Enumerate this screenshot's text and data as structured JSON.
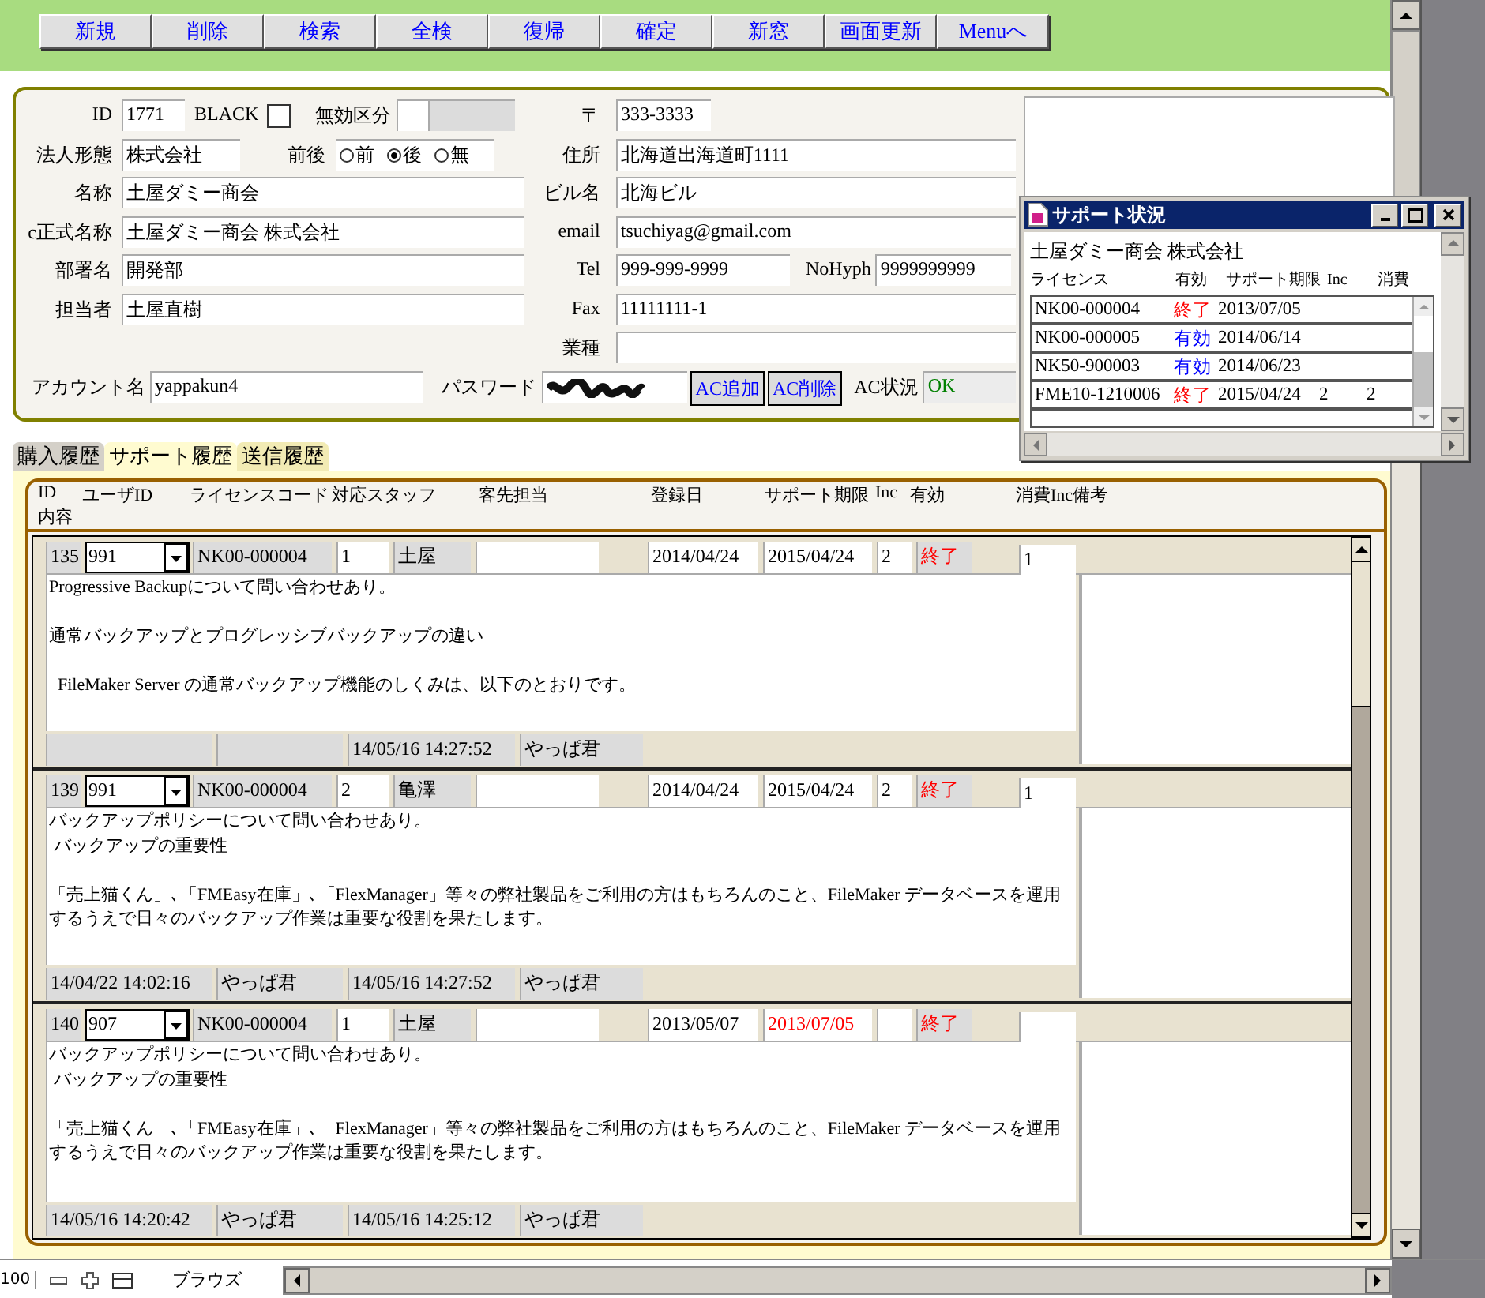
{
  "toolbar": {
    "buttons": [
      "新規",
      "削除",
      "検索",
      "全検",
      "復帰",
      "確定",
      "新窓",
      "画面更新",
      "Menuへ"
    ]
  },
  "form": {
    "id": {
      "label": "ID",
      "value": "1771"
    },
    "black": {
      "label": "BLACK",
      "checked": false
    },
    "invalid": {
      "label": "無効区分"
    },
    "corp_type": {
      "label": "法人形態",
      "value": "株式会社"
    },
    "position": {
      "label": "前後",
      "options": [
        {
          "label": "前",
          "selected": false
        },
        {
          "label": "後",
          "selected": true
        },
        {
          "label": "無",
          "selected": false
        }
      ]
    },
    "left_fields": [
      {
        "label": "名称",
        "value": "土屋ダミー商会"
      },
      {
        "label": "c正式名称",
        "value": "土屋ダミー商会 株式会社"
      },
      {
        "label": "部署名",
        "value": "開発部"
      },
      {
        "label": "担当者",
        "value": "土屋直樹"
      }
    ],
    "right_fields": [
      {
        "label": "〒",
        "value": "333-3333",
        "kind": "short"
      },
      {
        "label": "住所",
        "value": "北海道出海道町1111",
        "kind": "wide"
      },
      {
        "label": "ビル名",
        "value": "北海ビル",
        "kind": "wide"
      },
      {
        "label": "email",
        "value": "tsuchiyag@gmail.com",
        "kind": "wide"
      },
      {
        "label": "Tel",
        "value": "999-999-9999",
        "kind": "pair",
        "extra": {
          "label": "NoHyph",
          "value": "9999999999"
        }
      },
      {
        "label": "Fax",
        "value": "11111111-1",
        "kind": "wide"
      },
      {
        "label": "業種",
        "kind": "wide"
      }
    ],
    "account": {
      "label": "アカウント名",
      "value": "yappakun4"
    },
    "password": {
      "label": "パスワード"
    },
    "ac_buttons": [
      "AC追加",
      "AC削除"
    ],
    "ac_status": {
      "label": "AC状況",
      "value": "OK"
    }
  },
  "tabs": [
    {
      "label": "購入履歴",
      "selected": false
    },
    {
      "label": "サポート履歴",
      "selected": true
    },
    {
      "label": "送信履歴",
      "selected": false
    }
  ],
  "columns": [
    "ID",
    "ユーザID",
    "ライセンスコード",
    "対応スタッフ",
    "客先担当",
    "登録日",
    "サポート期限",
    "Inc",
    "有効",
    "消費Inc備考",
    "内容"
  ],
  "records": [
    {
      "id": "135",
      "user_id": "991",
      "license": "NK00-000004",
      "staff_no": "1",
      "staff": "土屋",
      "registered": "2014/04/24",
      "support_end": {
        "text": "2015/04/24",
        "color": "#000000"
      },
      "inc": "2",
      "status": {
        "text": "終了",
        "color": "#ff0000"
      },
      "consumed": "1",
      "content": [
        {
          "text": "Progressive Backupについて問い合わせあり。",
          "gap_before": false
        },
        {
          "text": "通常バックアップとプログレッシブバックアップの違い",
          "gap_before": true
        },
        {
          "text": "  FileMaker Server の通常バックアップ機能のしくみは、以下のとおりです。",
          "gap_before": true
        }
      ],
      "modified": "14/05/16 14:27:52",
      "modified_by": "やっぱ君"
    },
    {
      "id": "139",
      "user_id": "991",
      "license": "NK00-000004",
      "staff_no": "2",
      "staff": "亀澤",
      "registered": "2014/04/24",
      "support_end": {
        "text": "2015/04/24",
        "color": "#000000"
      },
      "inc": "2",
      "status": {
        "text": "終了",
        "color": "#ff0000"
      },
      "consumed": "1",
      "content": [
        {
          "text": "バックアップポリシーについて問い合わせあり。",
          "gap_before": false
        },
        {
          "text": " バックアップの重要性",
          "gap_before": false
        },
        {
          "text": "「売上猫くん」､「FMEasy在庫」､「FlexManager」等々の弊社製品をご利用の方はもちろんのこと、FileMaker データベースを運用するうえで日々のバックアップ作業は重要な役割を果たします。",
          "gap_before": true
        }
      ],
      "created": "14/04/22 14:02:16",
      "created_by": "やっぱ君",
      "modified": "14/05/16 14:27:52",
      "modified_by": "やっぱ君"
    },
    {
      "id": "140",
      "user_id": "907",
      "license": "NK00-000004",
      "staff_no": "1",
      "staff": "土屋",
      "registered": "2013/05/07",
      "support_end": {
        "text": "2013/07/05",
        "color": "#ff0000"
      },
      "status": {
        "text": "終了",
        "color": "#ff0000"
      },
      "content": [
        {
          "text": "バックアップポリシーについて問い合わせあり。",
          "gap_before": false
        },
        {
          "text": " バックアップの重要性",
          "gap_before": false
        },
        {
          "text": "「売上猫くん」､「FMEasy在庫」､「FlexManager」等々の弊社製品をご利用の方はもちろんのこと、FileMaker データベースを運用するうえで日々のバックアップ作業は重要な役割を果たします。",
          "gap_before": true
        }
      ],
      "created": "14/05/16 14:20:42",
      "created_by": "やっぱ君",
      "modified": "14/05/16 14:25:12",
      "modified_by": "やっぱ君"
    }
  ],
  "popup": {
    "title": "サポート状況",
    "company": "土屋ダミー商会 株式会社",
    "columns": [
      "ライセンス",
      "有効",
      "サポート期限",
      "Inc",
      "消費"
    ],
    "rows": [
      {
        "license": "NK00-000004",
        "status": "終了",
        "color": "#ff0000",
        "end": "2013/07/05"
      },
      {
        "license": "NK00-000005",
        "status": "有効",
        "color": "#0000ff",
        "end": "2014/06/14"
      },
      {
        "license": "NK50-900003",
        "status": "有効",
        "color": "#0000ff",
        "end": "2014/06/23"
      },
      {
        "license": "FME10-1210006",
        "status": "終了",
        "color": "#ff0000",
        "end": "2015/04/24",
        "inc": "2",
        "consumed": "2"
      }
    ]
  },
  "status_bar": {
    "zoom": "100",
    "mode": "ブラウズ"
  }
}
